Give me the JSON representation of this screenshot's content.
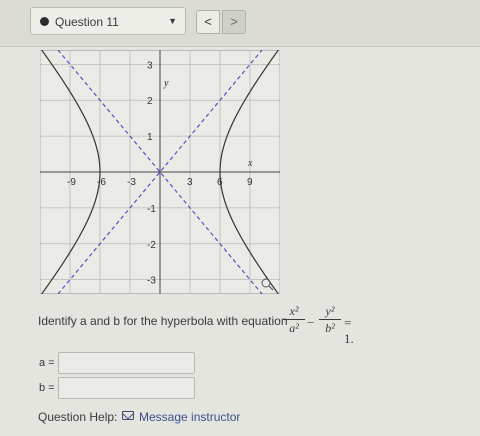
{
  "header": {
    "question_label": "Question 11",
    "dropdown_caret": "▼",
    "prev_label": "<",
    "next_label": ">"
  },
  "graph": {
    "x_ticks": [
      "-9",
      "-6",
      "-3",
      "3",
      "6",
      "9"
    ],
    "y_ticks": [
      "3",
      "2",
      "1",
      "-1",
      "-2",
      "-3"
    ],
    "x_axis_label": "x",
    "y_axis_label": "y",
    "xlim": [
      -12,
      12
    ],
    "ylim": [
      -3.4,
      3.4
    ],
    "hyperbola": {
      "a": 6,
      "b": 2
    },
    "asymptote_color": "#4b42c8",
    "curve_color": "#333333",
    "magnify_icon": "magnifier-icon"
  },
  "question": {
    "prompt": "Identify a and b for the hyperbola with equation",
    "eq_num1": "x²",
    "eq_den1": "a²",
    "eq_minus": "−",
    "eq_num2": "y²",
    "eq_den2": "b²",
    "eq_equals": "= 1."
  },
  "answers": {
    "a_label": "a =",
    "a_value": "",
    "b_label": "b =",
    "b_value": ""
  },
  "footer": {
    "help_label": "Question Help:",
    "message_label": "Message instructor",
    "mail_icon": "mail-icon"
  }
}
